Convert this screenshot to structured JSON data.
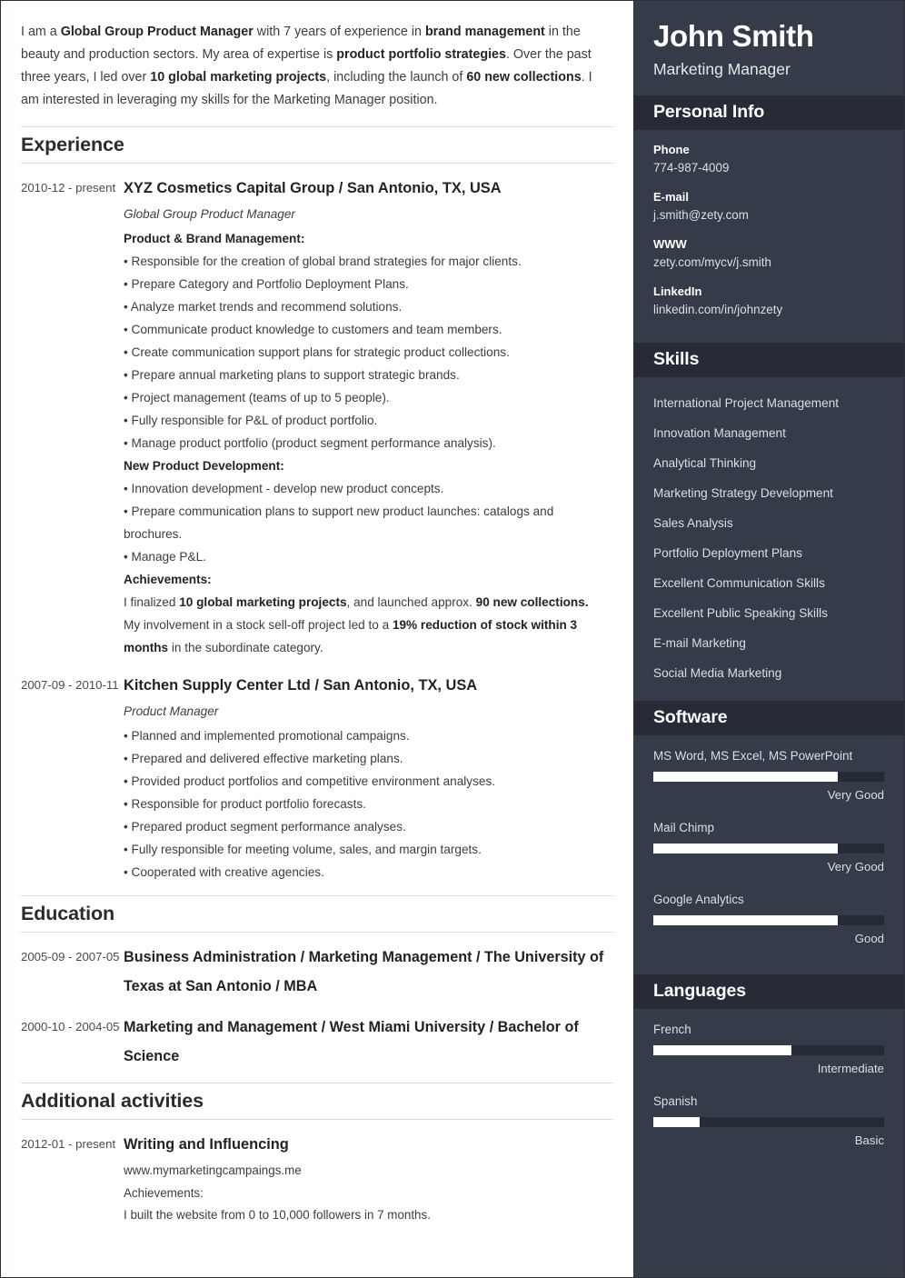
{
  "theme": {
    "sidebar_bg": "#353b48",
    "sidebar_header_bg": "#272b36",
    "bar_fill": "#ffffff",
    "bar_track": "#252a36",
    "page_bg": "#ffffff",
    "text": "#3d3d3d"
  },
  "summary": {
    "parts": [
      {
        "t": "I am a ",
        "b": false
      },
      {
        "t": "Global Group Product Manager",
        "b": true
      },
      {
        "t": " with 7 years of experience in ",
        "b": false
      },
      {
        "t": "brand management",
        "b": true
      },
      {
        "t": " in the beauty and production sectors. My area of expertise is ",
        "b": false
      },
      {
        "t": "product portfolio strategies",
        "b": true
      },
      {
        "t": ". Over the past three years, I led over ",
        "b": false
      },
      {
        "t": "10 global marketing projects",
        "b": true
      },
      {
        "t": ", including the launch of ",
        "b": false
      },
      {
        "t": "60 new collections",
        "b": true
      },
      {
        "t": ". I am interested in leveraging my skills for the Marketing Manager position.",
        "b": false
      }
    ]
  },
  "sections": {
    "experience": {
      "heading": "Experience",
      "entries": [
        {
          "dates": "2010-12 - present",
          "title": "XYZ Cosmetics Capital Group / San Antonio, TX, USA",
          "subtitle": "Global Group Product Manager",
          "blocks": [
            {
              "kind": "group",
              "text": "Product & Brand Management:"
            },
            {
              "kind": "bullet",
              "text": "• Responsible for the creation of global brand strategies for major clients."
            },
            {
              "kind": "bullet",
              "text": "• Prepare Category and Portfolio Deployment Plans."
            },
            {
              "kind": "bullet",
              "text": "• Analyze market trends and recommend solutions."
            },
            {
              "kind": "bullet",
              "text": "• Communicate product knowledge to customers and team members."
            },
            {
              "kind": "bullet",
              "text": "• Create communication support plans for strategic product collections."
            },
            {
              "kind": "bullet",
              "text": "• Prepare annual marketing plans to support strategic brands."
            },
            {
              "kind": "bullet",
              "text": "• Project management (teams of up to 5 people)."
            },
            {
              "kind": "bullet",
              "text": "• Fully responsible for P&L of product portfolio."
            },
            {
              "kind": "bullet",
              "text": "• Manage product portfolio (product segment performance analysis)."
            },
            {
              "kind": "group",
              "text": "New Product Development:"
            },
            {
              "kind": "bullet",
              "text": "• Innovation development - develop new product concepts."
            },
            {
              "kind": "bullet",
              "text": "• Prepare communication plans to support new product launches: catalogs and brochures."
            },
            {
              "kind": "bullet",
              "text": "• Manage P&L."
            },
            {
              "kind": "group",
              "text": "Achievements:"
            },
            {
              "kind": "rich",
              "parts": [
                {
                  "t": "I finalized ",
                  "b": false
                },
                {
                  "t": "10 global marketing projects",
                  "b": true
                },
                {
                  "t": ", and launched approx. ",
                  "b": false
                },
                {
                  "t": "90 new collections.",
                  "b": true
                }
              ]
            },
            {
              "kind": "rich",
              "parts": [
                {
                  "t": "My involvement in a stock sell-off project led to a ",
                  "b": false
                },
                {
                  "t": "19% reduction of stock within 3 months",
                  "b": true
                },
                {
                  "t": " in the subordinate category.",
                  "b": false
                }
              ]
            }
          ]
        },
        {
          "dates": "2007-09 - 2010-11",
          "title": "Kitchen Supply Center Ltd / San Antonio, TX, USA",
          "subtitle": "Product Manager",
          "blocks": [
            {
              "kind": "bullet",
              "text": "• Planned and implemented promotional campaigns."
            },
            {
              "kind": "bullet",
              "text": "• Prepared and delivered effective marketing plans."
            },
            {
              "kind": "bullet",
              "text": "• Provided product portfolios and competitive environment analyses."
            },
            {
              "kind": "bullet",
              "text": "• Responsible for product portfolio forecasts."
            },
            {
              "kind": "bullet",
              "text": "• Prepared product segment performance analyses."
            },
            {
              "kind": "bullet",
              "text": "• Fully responsible for meeting volume, sales, and margin targets."
            },
            {
              "kind": "bullet",
              "text": "• Cooperated with creative agencies."
            }
          ]
        }
      ]
    },
    "education": {
      "heading": "Education",
      "entries": [
        {
          "dates": "2005-09 - 2007-05",
          "title": "Business Administration / Marketing Management / The University of Texas at San Antonio / MBA"
        },
        {
          "dates": "2000-10 - 2004-05",
          "title": "Marketing and Management / West Miami University / Bachelor of Science"
        }
      ]
    },
    "additional": {
      "heading": "Additional activities",
      "entries": [
        {
          "dates": "2012-01 - present",
          "title": "Writing and Influencing",
          "lines": [
            "www.mymarketingcampaings.me",
            "Achievements:",
            "I built the website from 0 to 10,000 followers in 7 months."
          ]
        }
      ]
    }
  },
  "sidebar": {
    "name": "John Smith",
    "role": "Marketing Manager",
    "personal_info": {
      "heading": "Personal Info",
      "items": [
        {
          "label": "Phone",
          "value": "774-987-4009"
        },
        {
          "label": "E-mail",
          "value": "j.smith@zety.com"
        },
        {
          "label": "WWW",
          "value": "zety.com/mycv/j.smith"
        },
        {
          "label": "LinkedIn",
          "value": "linkedin.com/in/johnzety"
        }
      ]
    },
    "skills": {
      "heading": "Skills",
      "items": [
        "International Project Management",
        "Innovation Management",
        "Analytical Thinking",
        "Marketing Strategy Development",
        "Sales Analysis",
        "Portfolio Deployment Plans",
        "Excellent Communication Skills",
        "Excellent Public Speaking Skills",
        "E-mail Marketing",
        "Social Media Marketing"
      ]
    },
    "software": {
      "heading": "Software",
      "items": [
        {
          "name": "MS Word, MS Excel, MS PowerPoint",
          "level": "Very Good",
          "percent": 80
        },
        {
          "name": "Mail Chimp",
          "level": "Very Good",
          "percent": 80
        },
        {
          "name": "Google Analytics",
          "level": "Good",
          "percent": 80
        }
      ]
    },
    "languages": {
      "heading": "Languages",
      "items": [
        {
          "name": "French",
          "level": "Intermediate",
          "percent": 60
        },
        {
          "name": "Spanish",
          "level": "Basic",
          "percent": 20
        }
      ]
    }
  }
}
